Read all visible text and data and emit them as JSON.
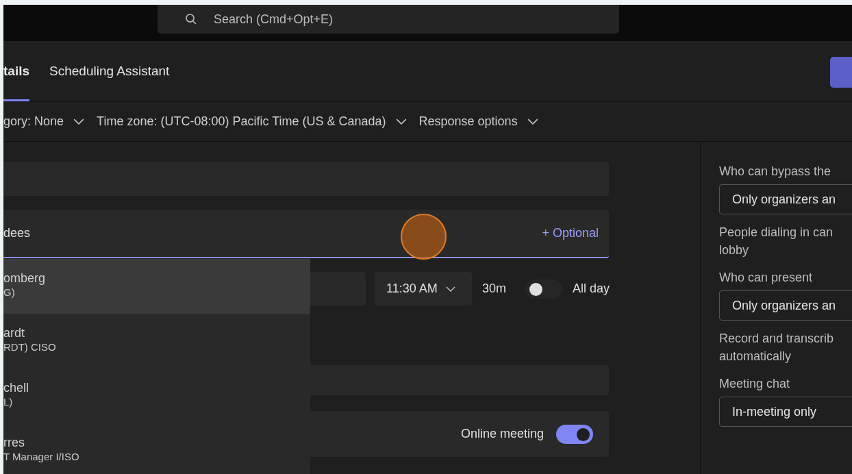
{
  "search": {
    "placeholder": "Search (Cmd+Opt+E)"
  },
  "tabs": [
    {
      "label": "tails",
      "selected": true
    },
    {
      "label": "Scheduling Assistant",
      "selected": false
    }
  ],
  "options_bar": [
    {
      "label": "gory: None"
    },
    {
      "label": "Time zone: (UTC-08:00) Pacific Time (US & Canada)"
    },
    {
      "label": "Response options"
    }
  ],
  "attendees": {
    "placeholder": "dees",
    "optional_link": "+ Optional"
  },
  "time": {
    "start": "11:30 AM",
    "duration": "30m",
    "all_day": {
      "label": "All day",
      "on": false
    }
  },
  "online_meeting": {
    "label": "Online meeting",
    "on": true
  },
  "suggestions": [
    {
      "name": "omberg",
      "detail": "G)",
      "selected": true
    },
    {
      "name": "ardt",
      "detail": "RDT) CISO",
      "selected": false
    },
    {
      "name": "chell",
      "detail": "L)",
      "selected": false
    },
    {
      "name": "rres",
      "detail": "T Manager I/ISO",
      "selected": false
    }
  ],
  "meeting_options": [
    {
      "kind": "select",
      "label": "Who can bypass the",
      "value": "Only organizers an"
    },
    {
      "kind": "text",
      "label": "People dialing in can lobby"
    },
    {
      "kind": "select",
      "label": "Who can present",
      "value": "Only organizers an"
    },
    {
      "kind": "text",
      "label": "Record and transcrib\nautomatically"
    },
    {
      "kind": "select",
      "label": "Meeting chat",
      "value": "In-meeting only"
    }
  ]
}
